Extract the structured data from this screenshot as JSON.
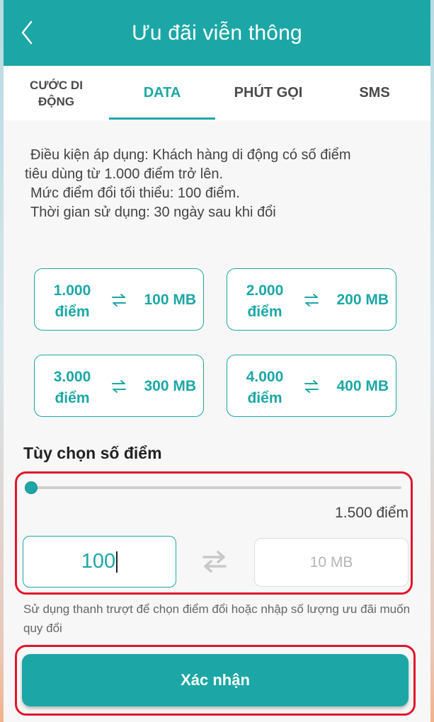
{
  "header": {
    "title": "Ưu đãi viễn thông",
    "back_icon": "chevron-left-icon"
  },
  "tabs": [
    {
      "label": "CƯỚC DI ĐỘNG",
      "active": false
    },
    {
      "label": "DATA",
      "active": true
    },
    {
      "label": "PHÚT GỌI",
      "active": false
    },
    {
      "label": "SMS",
      "active": false
    }
  ],
  "conditions": {
    "line1": "Điều kiện áp dụng: Khách hàng di động có số điểm",
    "line2": "tiêu dùng từ 1.000 điểm trở lên.",
    "line3": "Mức điểm đổi tối thiểu: 100 điểm.",
    "line4": "Thời gian sử dụng: 30 ngày sau khi đổi"
  },
  "packages": [
    {
      "points_line1": "1.000",
      "points_line2": "điểm",
      "amount": "100 MB"
    },
    {
      "points_line1": "2.000",
      "points_line2": "điểm",
      "amount": "200 MB"
    },
    {
      "points_line1": "3.000",
      "points_line2": "điểm",
      "amount": "300 MB"
    },
    {
      "points_line1": "4.000",
      "points_line2": "điểm",
      "amount": "400 MB"
    }
  ],
  "custom": {
    "title": "Tùy chọn số điểm",
    "slider_value_label": "1.500 điểm",
    "points_input_value": "100",
    "result_placeholder": "10 MB",
    "hint": "Sử dụng thanh trượt để chọn điểm đổi hoặc nhập số lượng ưu đãi muốn quy đổi"
  },
  "confirm_label": "Xác nhận",
  "colors": {
    "accent": "#1ca7a6",
    "highlight": "#e0162b"
  }
}
